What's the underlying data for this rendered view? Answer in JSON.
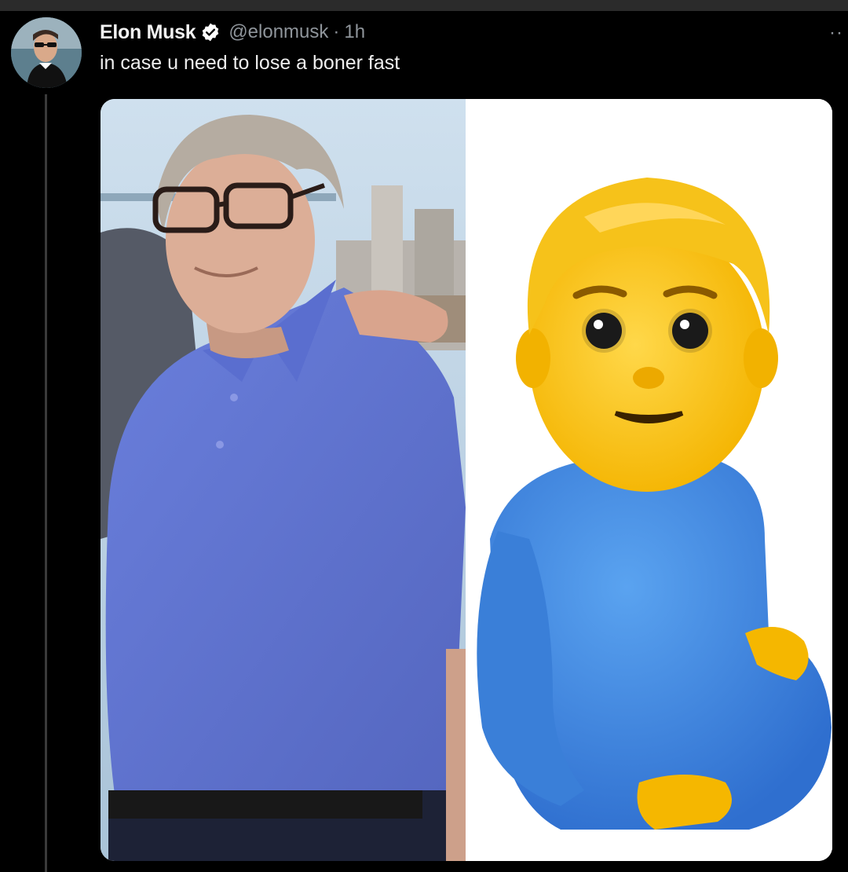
{
  "tweet": {
    "author_name": "Elon Musk",
    "handle": "@elonmusk",
    "separator": "·",
    "timestamp": "1h",
    "text": "in case u need to lose a boner fast",
    "more_label": "··"
  },
  "icons": {
    "verified": "verified-badge-icon",
    "more": "more-options-icon"
  },
  "colors": {
    "background": "#000000",
    "name_text": "#f2f2f2",
    "muted_text": "#8f959b",
    "verified_blue": "#ffffff"
  }
}
